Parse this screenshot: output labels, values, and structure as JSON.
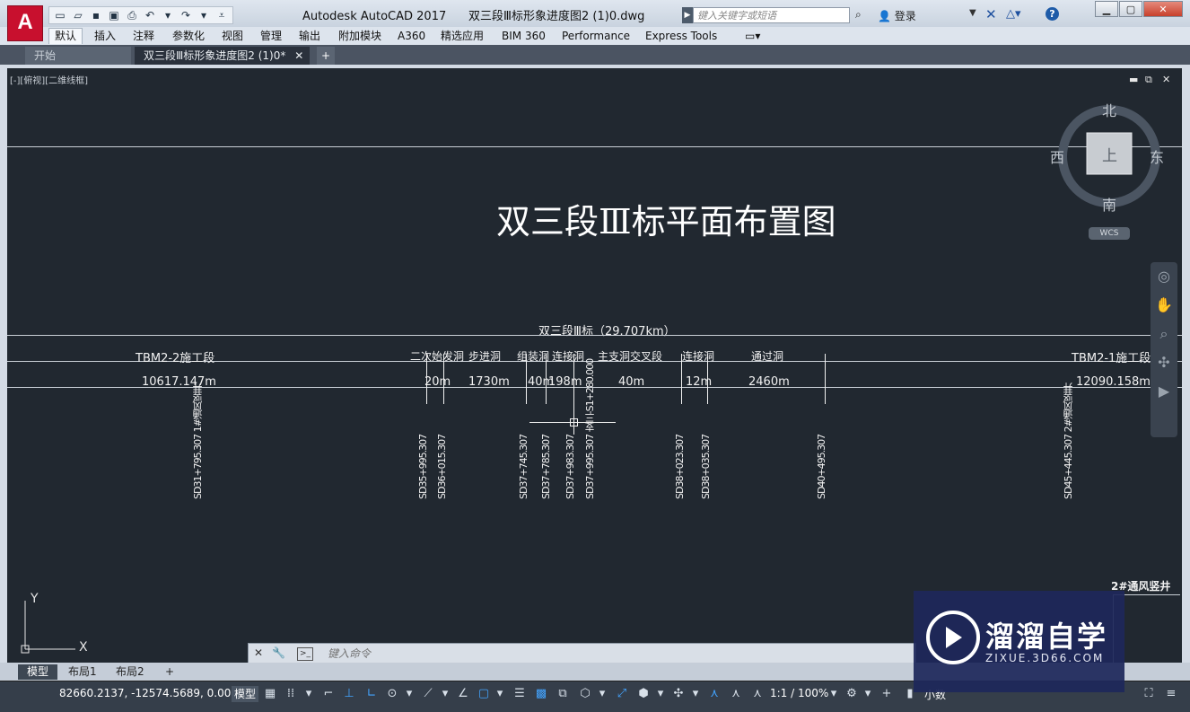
{
  "titlebar": {
    "app_name": "Autodesk AutoCAD 2017",
    "file_name": "双三段Ⅲ标形象进度图2 (1)0.dwg",
    "search_placeholder": "键入关键字或短语",
    "login_label": "登录",
    "app_logo": "A"
  },
  "ribbon": {
    "tabs": [
      "默认",
      "插入",
      "注释",
      "参数化",
      "视图",
      "管理",
      "输出",
      "附加模块",
      "A360",
      "精选应用",
      "BIM 360",
      "Performance",
      "Express Tools"
    ]
  },
  "doc_tabs": {
    "start": "开始",
    "drawing": "双三段Ⅲ标形象进度图2 (1)0*",
    "add": "+"
  },
  "canvas": {
    "viewport_label": "[-][俯视][二维线框]",
    "title": "双三段Ⅲ标平面布置图",
    "section_header": "双三段Ⅲ标（29.707km）",
    "left_segment": "TBM2-2施工段",
    "right_segment": "TBM2-1施工段",
    "left_length": "10617.147m",
    "right_length": "12090.158m",
    "segments": [
      {
        "name": "二次始发洞",
        "length": "20m"
      },
      {
        "name": "步进洞",
        "length": "1730m"
      },
      {
        "name": "组装洞",
        "length": "40m"
      },
      {
        "name": "连接洞",
        "length": "198m"
      },
      {
        "name": "主支洞交叉段",
        "length": "40m"
      },
      {
        "name": "连接洞",
        "length": "12m"
      },
      {
        "name": "通过洞",
        "length": "2460m"
      }
    ],
    "stations": [
      "SD31+795.307 1#通风竖井",
      "SD35+995.307",
      "SD36+015.307",
      "SD37+745.307",
      "SD37+785.307",
      "SD37+983.307",
      "SD37+995.307 支三-S1+280.000",
      "SD38+023.307",
      "SD38+035.307",
      "SD40+495.307",
      "SD45+445.307 2#通风竖井"
    ],
    "right_note": "2#通风竖井"
  },
  "viewcube": {
    "north": "北",
    "south": "南",
    "east": "东",
    "west": "西",
    "face": "上",
    "wcs": "WCS"
  },
  "ucs": {
    "x": "X",
    "y": "Y"
  },
  "command_line": {
    "placeholder": "键入命令"
  },
  "layout_tabs": [
    "模型",
    "布局1",
    "布局2",
    "+"
  ],
  "status_bar": {
    "coords": "82660.2137, -12574.5689, 0.0000",
    "model": "模型",
    "scale": "1:1 / 100%",
    "annotation": "小数"
  },
  "watermark": {
    "title": "溜溜自学",
    "sub": "ZIXUE.3D66.COM"
  }
}
